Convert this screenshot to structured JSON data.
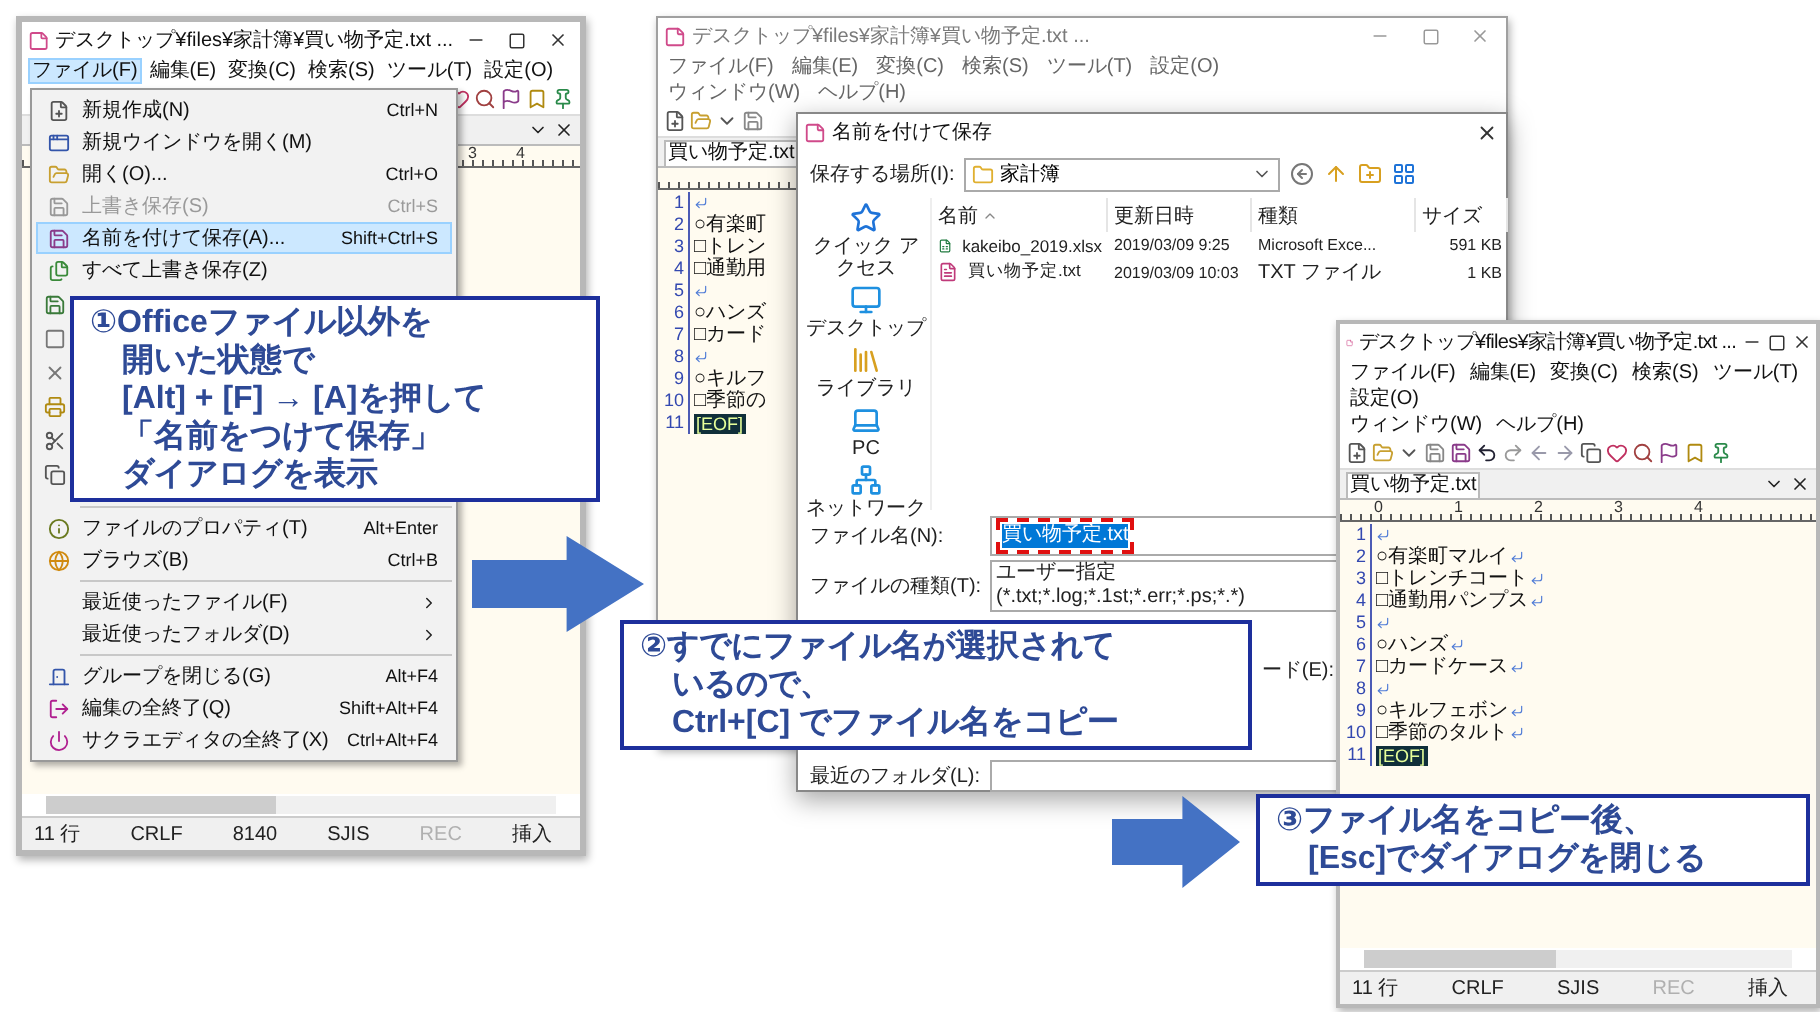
{
  "left_window": {
    "title": "デスクトップ¥files¥家計簿¥買い物予定.txt ...",
    "menu_rows": [
      [
        {
          "label": "ファイル(F)",
          "selected": true
        },
        {
          "label": "編集(E)",
          "selected": false
        },
        {
          "label": "変換(C)",
          "selected": false
        },
        {
          "label": "検索(S)",
          "selected": false
        },
        {
          "label": "ツール(T)",
          "selected": false
        },
        {
          "label": "設定(O)",
          "selected": false
        }
      ]
    ],
    "file_menu": {
      "groups": [
        [
          {
            "label": "新規作成(N)",
            "shortcut": "Ctrl+N",
            "icon": true,
            "disabled": false,
            "selected": false,
            "submenu": false
          },
          {
            "label": "新規ウインドウを開く(M)",
            "icon": true,
            "disabled": false,
            "selected": false,
            "submenu": false
          },
          {
            "label": "開く(O)...",
            "shortcut": "Ctrl+O",
            "icon": true,
            "disabled": false,
            "selected": false,
            "submenu": false
          },
          {
            "label": "上書き保存(S)",
            "shortcut": "Ctrl+S",
            "icon": true,
            "disabled": true,
            "selected": false,
            "submenu": false
          },
          {
            "label": "名前を付けて保存(A)...",
            "shortcut": "Shift+Ctrl+S",
            "icon": true,
            "disabled": false,
            "selected": true,
            "submenu": false
          },
          {
            "label": "すべて上書き保存(Z)",
            "icon": true,
            "disabled": false,
            "selected": false,
            "submenu": false
          }
        ],
        [
          {
            "label": "ファイルのプロパティ(T)",
            "shortcut": "Alt+Enter",
            "icon": true,
            "disabled": false,
            "selected": false,
            "submenu": false
          },
          {
            "label": "ブラウズ(B)",
            "shortcut": "Ctrl+B",
            "icon": true,
            "disabled": false,
            "selected": false,
            "submenu": false
          }
        ],
        [
          {
            "label": "最近使ったファイル(F)",
            "icon": false,
            "disabled": false,
            "selected": false,
            "submenu": true
          },
          {
            "label": "最近使ったフォルダ(D)",
            "icon": false,
            "disabled": false,
            "selected": false,
            "submenu": true
          }
        ],
        [
          {
            "label": "グループを閉じる(G)",
            "shortcut": "Alt+F4",
            "icon": true,
            "disabled": false,
            "selected": false,
            "submenu": false
          },
          {
            "label": "編集の全終了(Q)",
            "shortcut": "Shift+Alt+F4",
            "icon": true,
            "disabled": false,
            "selected": false,
            "submenu": false
          },
          {
            "label": "サクラエディタの全終了(X)",
            "shortcut": "Ctrl+Alt+F4",
            "icon": true,
            "disabled": false,
            "selected": false,
            "submenu": false
          }
        ]
      ]
    },
    "ruler": [
      "3",
      "4"
    ],
    "status": [
      {
        "text": "11 行",
        "disabled": false
      },
      {
        "text": "CRLF",
        "disabled": false
      },
      {
        "text": "8140",
        "disabled": false
      },
      {
        "text": "SJIS",
        "disabled": false
      },
      {
        "text": "REC",
        "disabled": true
      },
      {
        "text": "挿入",
        "disabled": false
      }
    ]
  },
  "middle_window": {
    "title": "デスクトップ¥files¥家計簿¥買い物予定.txt ...",
    "menu_rows": [
      [
        {
          "label": "ファイル(F)",
          "selected": false
        },
        {
          "label": "編集(E)",
          "selected": false
        },
        {
          "label": "変換(C)",
          "selected": false
        },
        {
          "label": "検索(S)",
          "selected": false
        },
        {
          "label": "ツール(T)",
          "selected": false
        },
        {
          "label": "設定(O)",
          "selected": false
        }
      ],
      [
        {
          "label": "ウィンドウ(W)",
          "selected": false
        },
        {
          "label": "ヘルプ(H)",
          "selected": false
        }
      ]
    ],
    "tab": "買い物予定.txt",
    "lines": [
      {
        "number": "1",
        "eol": true
      },
      {
        "number": "2",
        "text": "○有楽町",
        "eol": false,
        "kind": "text"
      },
      {
        "number": "3",
        "text": "□トレン",
        "eol": false,
        "kind": "text"
      },
      {
        "number": "4",
        "text": "□通勤用",
        "eol": false,
        "kind": "text"
      },
      {
        "number": "5",
        "eol": true
      },
      {
        "number": "6",
        "text": "○ハンズ",
        "eol": false,
        "kind": "text"
      },
      {
        "number": "7",
        "text": "□カード",
        "eol": false,
        "kind": "text"
      },
      {
        "number": "8",
        "eol": true
      },
      {
        "number": "9",
        "text": "○キルフ",
        "eol": false,
        "kind": "text"
      },
      {
        "number": "10",
        "text": "□季節の",
        "eol": false,
        "kind": "text"
      },
      {
        "number": "11",
        "text": "[EOF]",
        "eol": false,
        "kind": "eof"
      }
    ]
  },
  "save_dialog": {
    "title": "名前を付けて保存",
    "location_label": "保存する場所(I):",
    "location": "家計簿",
    "places": [
      {
        "label": "クイック アクセス",
        "kind": "quick"
      },
      {
        "label": "デスクトップ",
        "kind": "desktop"
      },
      {
        "label": "ライブラリ",
        "kind": "library"
      },
      {
        "label": "PC",
        "kind": "pc"
      },
      {
        "label": "ネットワーク",
        "kind": "network"
      }
    ],
    "columns": [
      "名前",
      "更新日時",
      "種類",
      "サイズ"
    ],
    "files": [
      {
        "name": "kakeibo_2019.xlsx",
        "modified": "2019/03/09 9:25",
        "type": "Microsoft Exce...",
        "size": "591 KB",
        "kind": "spreadsheet"
      },
      {
        "name": "買い物予定.txt",
        "modified": "2019/03/09 10:03",
        "type": "TXT ファイル",
        "size": "1 KB",
        "kind": "text"
      }
    ],
    "filename_label": "ファイル名(N):",
    "filename": {
      "value": "買い物予定.txt",
      "selected": true,
      "annotated": true
    },
    "filetype_label": "ファイルの種類(T):",
    "filetype": "ユーザー指定 (*.txt;*.log;*.1st;*.err;*.ps;*.*)",
    "encoding_label": "ード(E):",
    "recent_label": "最近のフォルダ(L):"
  },
  "right_window": {
    "title": "デスクトップ¥files¥家計簿¥買い物予定.txt ...",
    "menu_rows": [
      [
        {
          "label": "ファイル(F)",
          "selected": false
        },
        {
          "label": "編集(E)",
          "selected": false
        },
        {
          "label": "変換(C)",
          "selected": false
        },
        {
          "label": "検索(S)",
          "selected": false
        },
        {
          "label": "ツール(T)",
          "selected": false
        },
        {
          "label": "設定(O)",
          "selected": false
        }
      ],
      [
        {
          "label": "ウィンドウ(W)",
          "selected": false
        },
        {
          "label": "ヘルプ(H)",
          "selected": false
        }
      ]
    ],
    "tab": "買い物予定.txt",
    "ruler": [
      "0",
      "1",
      "2",
      "3",
      "4"
    ],
    "lines": [
      {
        "number": "1",
        "eol": true
      },
      {
        "number": "2",
        "text": "○有楽町マルイ",
        "eol": true,
        "kind": "text"
      },
      {
        "number": "3",
        "text": "□トレンチコート",
        "eol": true,
        "kind": "text"
      },
      {
        "number": "4",
        "text": "□通勤用パンプス",
        "eol": true,
        "kind": "text"
      },
      {
        "number": "5",
        "eol": true
      },
      {
        "number": "6",
        "text": "○ハンズ",
        "eol": true,
        "kind": "text"
      },
      {
        "number": "7",
        "text": "□カードケース",
        "eol": true,
        "kind": "text"
      },
      {
        "number": "8",
        "eol": true
      },
      {
        "number": "9",
        "text": "○キルフェボン",
        "eol": true,
        "kind": "text"
      },
      {
        "number": "10",
        "text": "□季節のタルト",
        "eol": true,
        "kind": "text"
      },
      {
        "number": "11",
        "text": "[EOF]",
        "eol": false,
        "kind": "eof"
      }
    ],
    "status": [
      {
        "text": "11 行",
        "disabled": false
      },
      {
        "text": "CRLF",
        "disabled": false
      },
      {
        "text": "SJIS",
        "disabled": false
      },
      {
        "text": "REC",
        "disabled": true
      },
      {
        "text": "挿入",
        "disabled": false
      }
    ]
  },
  "callouts": [
    {
      "lines": [
        "①Officeファイル以外を",
        "開いた状態で",
        "[Alt] + [F] → [A]を押して",
        "「名前をつけて保存」",
        "ダイアログを表示"
      ]
    },
    {
      "lines": [
        "②すでにファイル名が選択されて",
        "いるので、",
        "Ctrl+[C] でファイル名をコピー"
      ]
    },
    {
      "lines": [
        "③ファイル名をコピー後、",
        "[Esc]でダイアログを閉じる"
      ]
    }
  ]
}
